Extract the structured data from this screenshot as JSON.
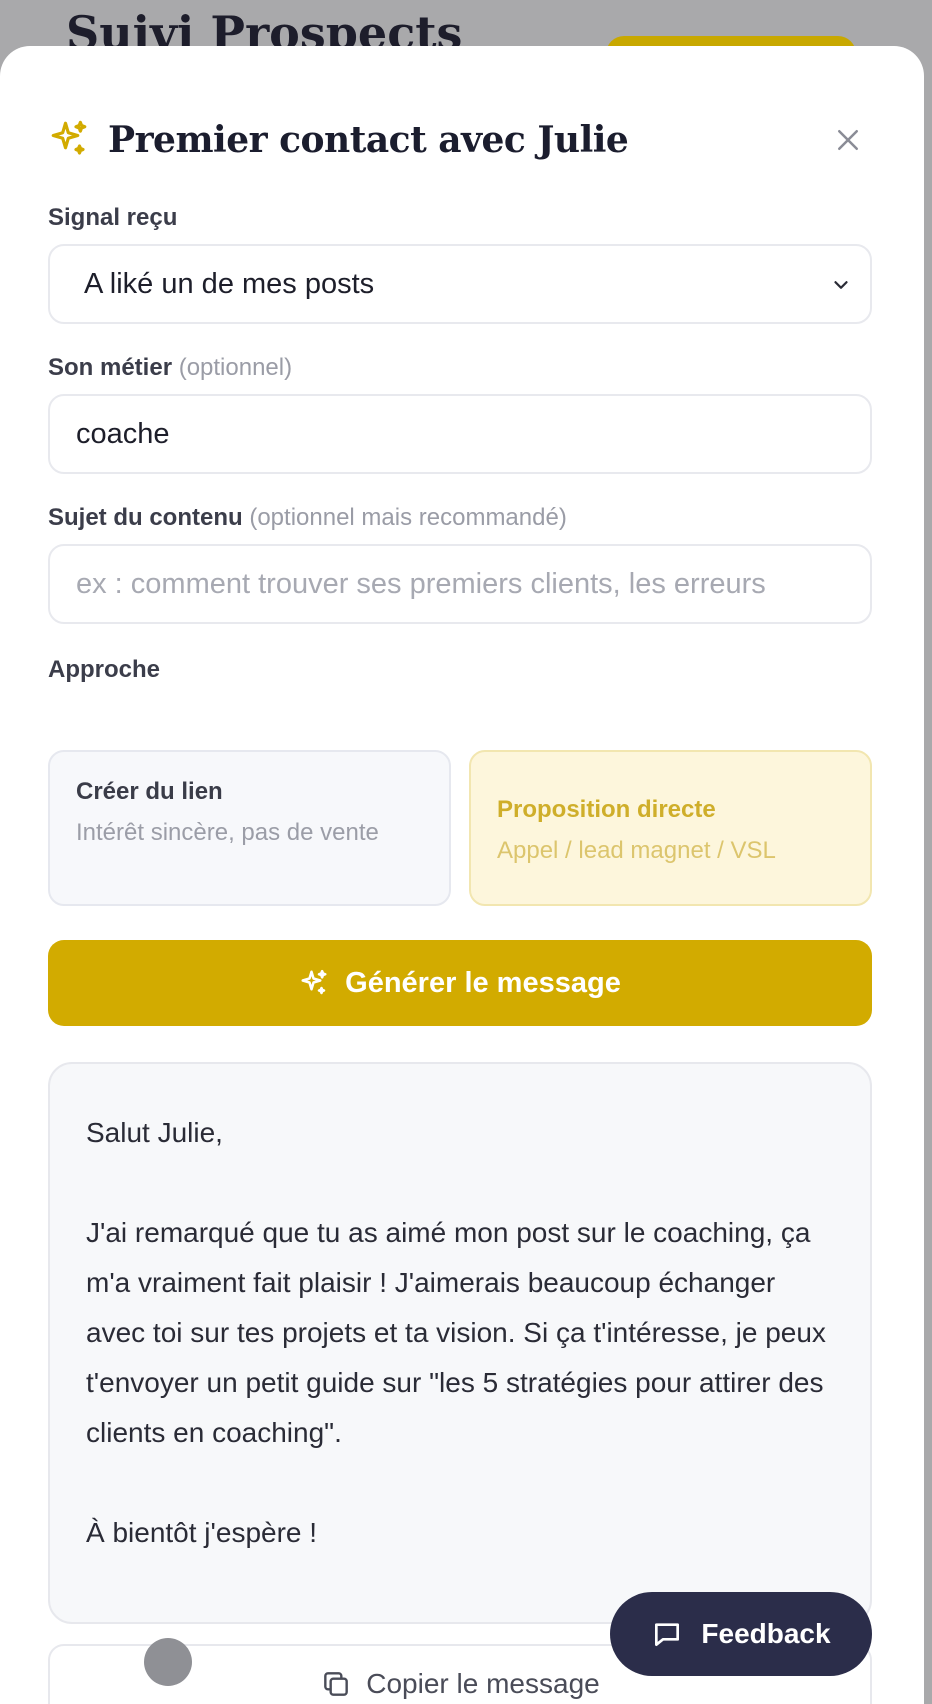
{
  "background": {
    "page_title": "Suivi Prospects"
  },
  "modal": {
    "title": "Premier contact avec Julie",
    "icon": "sparkles-icon",
    "close_icon": "close-icon"
  },
  "form": {
    "signal": {
      "label": "Signal reçu",
      "value": "A liké un de mes posts"
    },
    "job": {
      "label": "Son métier",
      "hint": "(optionnel)",
      "value": "coache"
    },
    "subject": {
      "label": "Sujet du contenu",
      "hint": "(optionnel mais recommandé)",
      "placeholder": "ex : comment trouver ses premiers clients, les erreurs"
    },
    "approach": {
      "label": "Approche",
      "options": [
        {
          "title": "Créer du lien",
          "desc": "Intérêt sincère, pas de vente",
          "selected": false
        },
        {
          "title": "Proposition directe",
          "desc": "Appel / lead magnet / VSL",
          "selected": true
        }
      ]
    }
  },
  "generate_button": {
    "label": "Générer le message"
  },
  "message": {
    "greeting": "Salut Julie,",
    "body": "J'ai remarqué que tu as aimé mon post sur le coaching, ça m'a vraiment fait plaisir ! J'aimerais beaucoup échanger avec toi sur tes projets et ta vision. Si ça t'intéresse, je peux t'envoyer un petit guide sur \"les 5 stratégies pour attirer des clients en coaching\".",
    "closing": "À bientôt j'espère !"
  },
  "copy_button": {
    "label": "Copier le message"
  },
  "feedback_button": {
    "label": "Feedback"
  },
  "colors": {
    "accent": "#d2ab00",
    "accent_light": "#fdf6dc",
    "dark": "#2b2d4a"
  }
}
